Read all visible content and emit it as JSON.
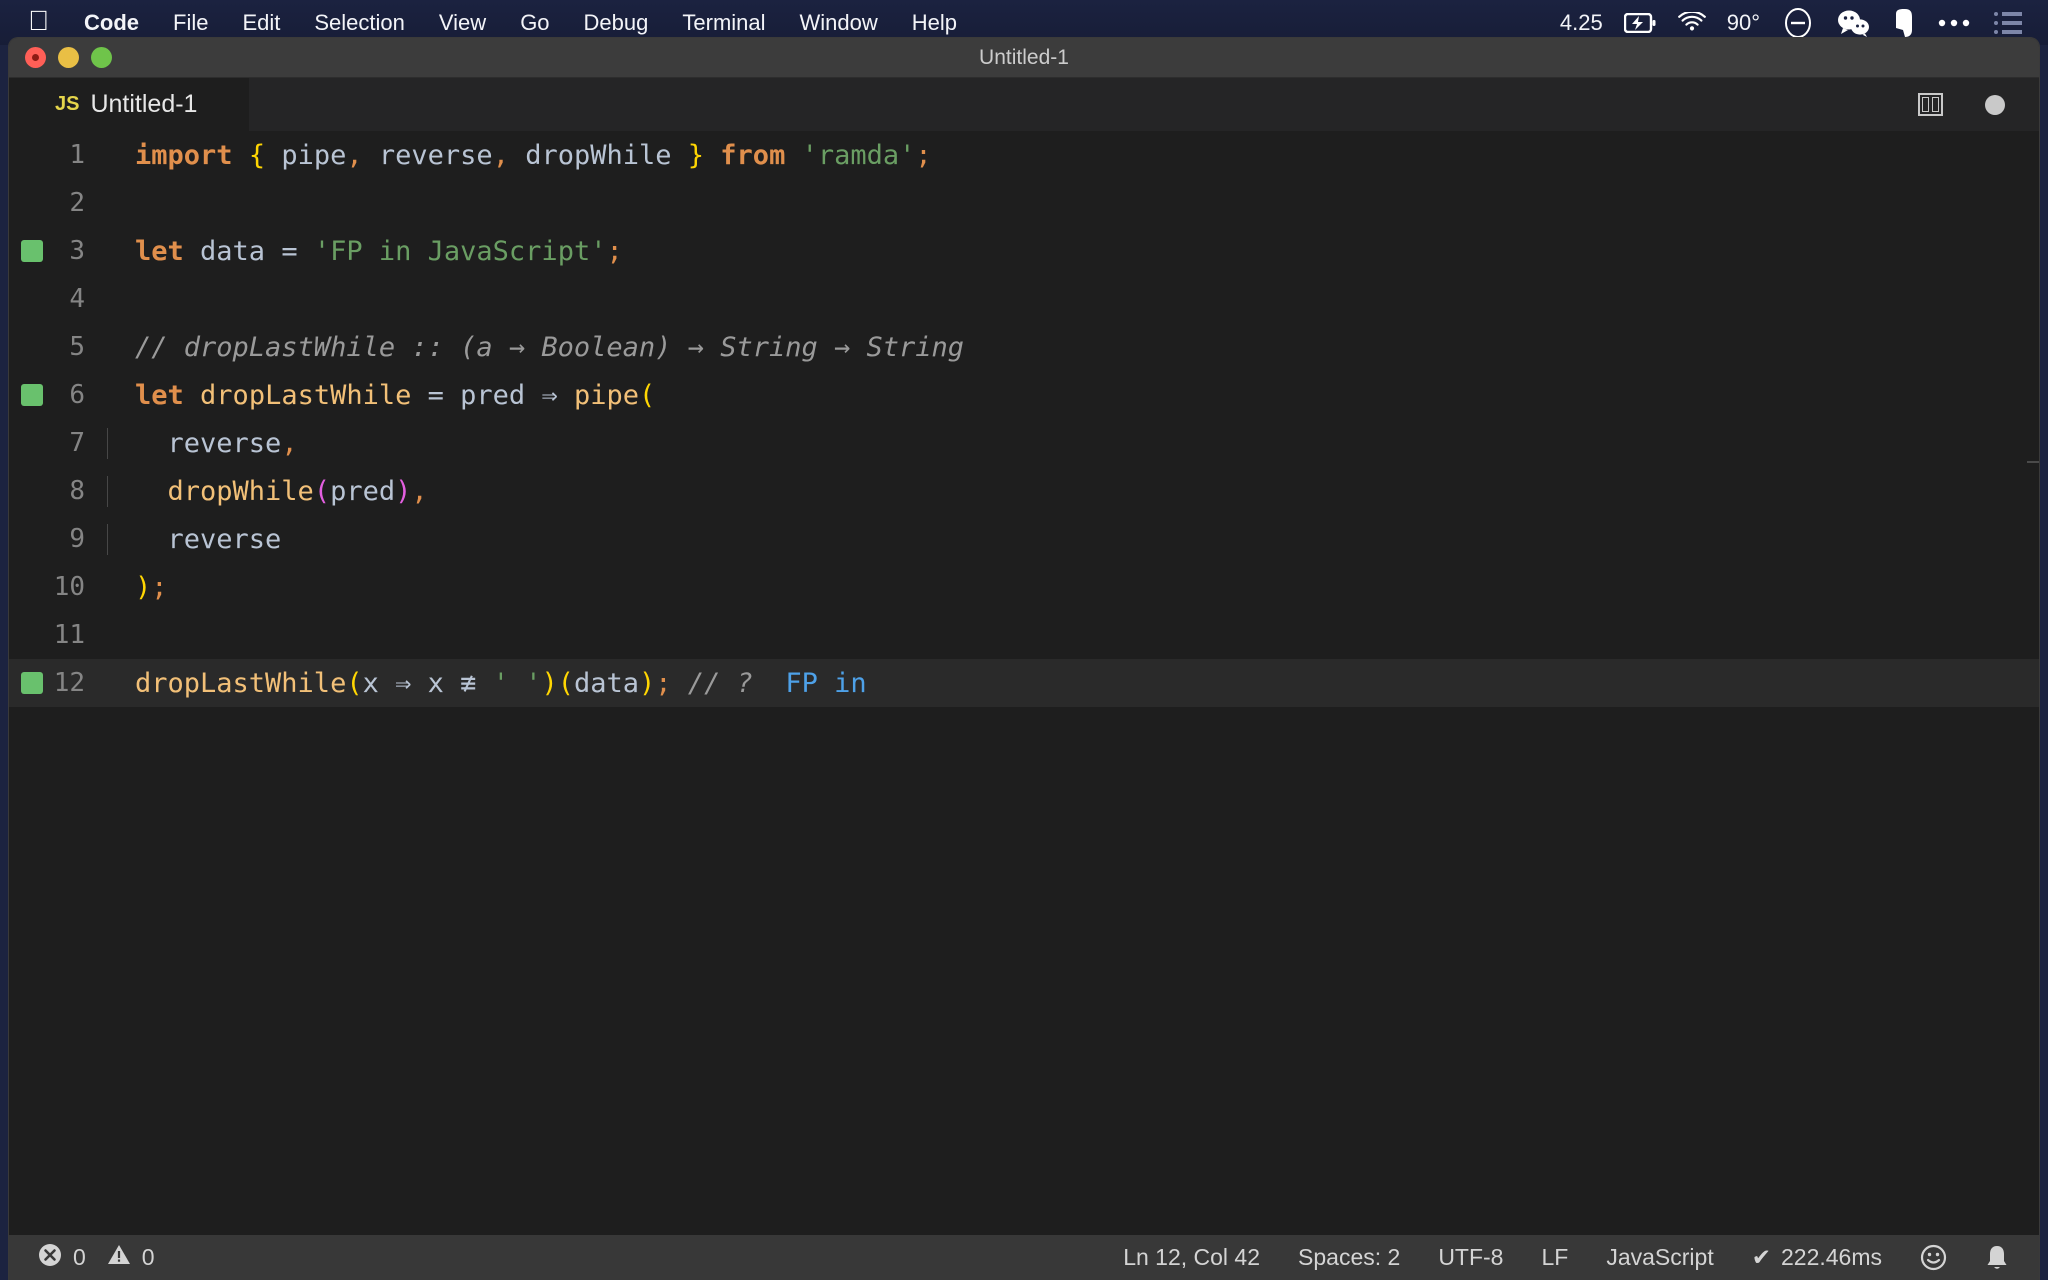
{
  "menubar": {
    "apple_icon": "apple-logo-icon",
    "items": [
      {
        "label": "Code",
        "bold": true
      },
      {
        "label": "File",
        "bold": false
      },
      {
        "label": "Edit",
        "bold": false
      },
      {
        "label": "Selection",
        "bold": false
      },
      {
        "label": "View",
        "bold": false
      },
      {
        "label": "Go",
        "bold": false
      },
      {
        "label": "Debug",
        "bold": false
      },
      {
        "label": "Terminal",
        "bold": false
      },
      {
        "label": "Window",
        "bold": false
      },
      {
        "label": "Help",
        "bold": false
      }
    ],
    "status": {
      "clock": "4.25",
      "battery_icon": "battery-charging-icon",
      "wifi_icon": "wifi-icon",
      "temperature": "90°",
      "dnd_icon": "do-not-disturb-icon",
      "wechat_icon": "wechat-icon",
      "evernote_icon": "evernote-icon",
      "more_icon": "ellipsis-icon",
      "list_icon": "list-menu-icon"
    }
  },
  "window": {
    "title": "Untitled-1",
    "traffic_lights": [
      "close-button",
      "minimize-button",
      "maximize-button"
    ]
  },
  "tabbar": {
    "active_tab": {
      "badge": "JS",
      "label": "Untitled-1"
    },
    "actions": {
      "split_editor": "split-editor-icon",
      "unsaved_dot": "unsaved-dot-icon"
    }
  },
  "editor": {
    "lines": [
      {
        "n": "1",
        "marker": false,
        "current": false,
        "indent_guide": false,
        "tokens": [
          {
            "t": "import",
            "c": "t-kw"
          },
          {
            "t": " ",
            "c": "t-plain"
          },
          {
            "t": "{",
            "c": "t-brace-y"
          },
          {
            "t": " ",
            "c": "t-plain"
          },
          {
            "t": "pipe",
            "c": "t-plain"
          },
          {
            "t": ",",
            "c": "t-punct"
          },
          {
            "t": " reverse",
            "c": "t-plain"
          },
          {
            "t": ",",
            "c": "t-punct"
          },
          {
            "t": " dropWhile ",
            "c": "t-plain"
          },
          {
            "t": "}",
            "c": "t-brace-y"
          },
          {
            "t": " ",
            "c": "t-plain"
          },
          {
            "t": "from",
            "c": "t-kw"
          },
          {
            "t": " ",
            "c": "t-plain"
          },
          {
            "t": "'ramda'",
            "c": "t-str"
          },
          {
            "t": ";",
            "c": "t-punct"
          }
        ]
      },
      {
        "n": "2",
        "marker": false,
        "current": false,
        "indent_guide": false,
        "tokens": []
      },
      {
        "n": "3",
        "marker": true,
        "current": false,
        "indent_guide": false,
        "tokens": [
          {
            "t": "let",
            "c": "t-kw"
          },
          {
            "t": " data ",
            "c": "t-plain"
          },
          {
            "t": "=",
            "c": "t-op"
          },
          {
            "t": " ",
            "c": "t-plain"
          },
          {
            "t": "'FP in JavaScript'",
            "c": "t-str"
          },
          {
            "t": ";",
            "c": "t-punct"
          }
        ]
      },
      {
        "n": "4",
        "marker": false,
        "current": false,
        "indent_guide": false,
        "tokens": []
      },
      {
        "n": "5",
        "marker": false,
        "current": false,
        "indent_guide": false,
        "tokens": [
          {
            "t": "// dropLastWhile :: (a → Boolean) → String → String",
            "c": "t-comment"
          }
        ]
      },
      {
        "n": "6",
        "marker": true,
        "current": false,
        "indent_guide": false,
        "tokens": [
          {
            "t": "let",
            "c": "t-kw"
          },
          {
            "t": " ",
            "c": "t-plain"
          },
          {
            "t": "dropLastWhile",
            "c": "t-fn"
          },
          {
            "t": " ",
            "c": "t-plain"
          },
          {
            "t": "=",
            "c": "t-op"
          },
          {
            "t": " pred ",
            "c": "t-plain"
          },
          {
            "t": "⇒",
            "c": "t-op"
          },
          {
            "t": " ",
            "c": "t-plain"
          },
          {
            "t": "pipe",
            "c": "t-fn"
          },
          {
            "t": "(",
            "c": "t-paren-y"
          }
        ]
      },
      {
        "n": "7",
        "marker": false,
        "current": false,
        "indent_guide": true,
        "tokens": [
          {
            "t": "  reverse",
            "c": "t-plain"
          },
          {
            "t": ",",
            "c": "t-punct"
          }
        ]
      },
      {
        "n": "8",
        "marker": false,
        "current": false,
        "indent_guide": true,
        "tokens": [
          {
            "t": "  ",
            "c": "t-plain"
          },
          {
            "t": "dropWhile",
            "c": "t-fn"
          },
          {
            "t": "(",
            "c": "t-paren-m"
          },
          {
            "t": "pred",
            "c": "t-plain"
          },
          {
            "t": ")",
            "c": "t-paren-m"
          },
          {
            "t": ",",
            "c": "t-punct"
          }
        ]
      },
      {
        "n": "9",
        "marker": false,
        "current": false,
        "indent_guide": true,
        "tokens": [
          {
            "t": "  reverse",
            "c": "t-plain"
          }
        ]
      },
      {
        "n": "10",
        "marker": false,
        "current": false,
        "indent_guide": false,
        "tokens": [
          {
            "t": ")",
            "c": "t-paren-y"
          },
          {
            "t": ";",
            "c": "t-punct"
          }
        ]
      },
      {
        "n": "11",
        "marker": false,
        "current": false,
        "indent_guide": false,
        "tokens": []
      },
      {
        "n": "12",
        "marker": true,
        "current": true,
        "indent_guide": false,
        "tokens": [
          {
            "t": "dropLastWhile",
            "c": "t-fn"
          },
          {
            "t": "(",
            "c": "t-paren-y"
          },
          {
            "t": "x ",
            "c": "t-plain"
          },
          {
            "t": "⇒",
            "c": "t-op"
          },
          {
            "t": " x ",
            "c": "t-plain"
          },
          {
            "t": "≢",
            "c": "t-op"
          },
          {
            "t": " ",
            "c": "t-plain"
          },
          {
            "t": "' '",
            "c": "t-str"
          },
          {
            "t": ")",
            "c": "t-paren-y"
          },
          {
            "t": "(",
            "c": "t-paren-y"
          },
          {
            "t": "data",
            "c": "t-plain"
          },
          {
            "t": ")",
            "c": "t-paren-y"
          },
          {
            "t": ";",
            "c": "t-punct"
          },
          {
            "t": " ",
            "c": "t-plain"
          },
          {
            "t": "// ?",
            "c": "t-comment"
          },
          {
            "t": "  ",
            "c": "t-plain"
          },
          {
            "t": "FP in",
            "c": "t-value"
          }
        ]
      }
    ]
  },
  "statusbar": {
    "errors": "0",
    "warnings": "0",
    "cursor": "Ln 12, Col 42",
    "spaces": "Spaces: 2",
    "encoding": "UTF-8",
    "eol": "LF",
    "language": "JavaScript",
    "quokka_time": "222.46ms",
    "quokka_check": "✔",
    "feedback_icon": "smiley-icon",
    "bell_icon": "bell-icon"
  },
  "colors": {
    "menubar_bg": "#1b2240",
    "titlebar_bg": "#3c3c3c",
    "tabbar_bg": "#252526",
    "editor_bg": "#1e1e1e",
    "current_line_bg": "#2a2a2a",
    "statusbar_bg": "#383838",
    "marker_green": "#69c16d",
    "js_yellow": "#e5d54b"
  }
}
